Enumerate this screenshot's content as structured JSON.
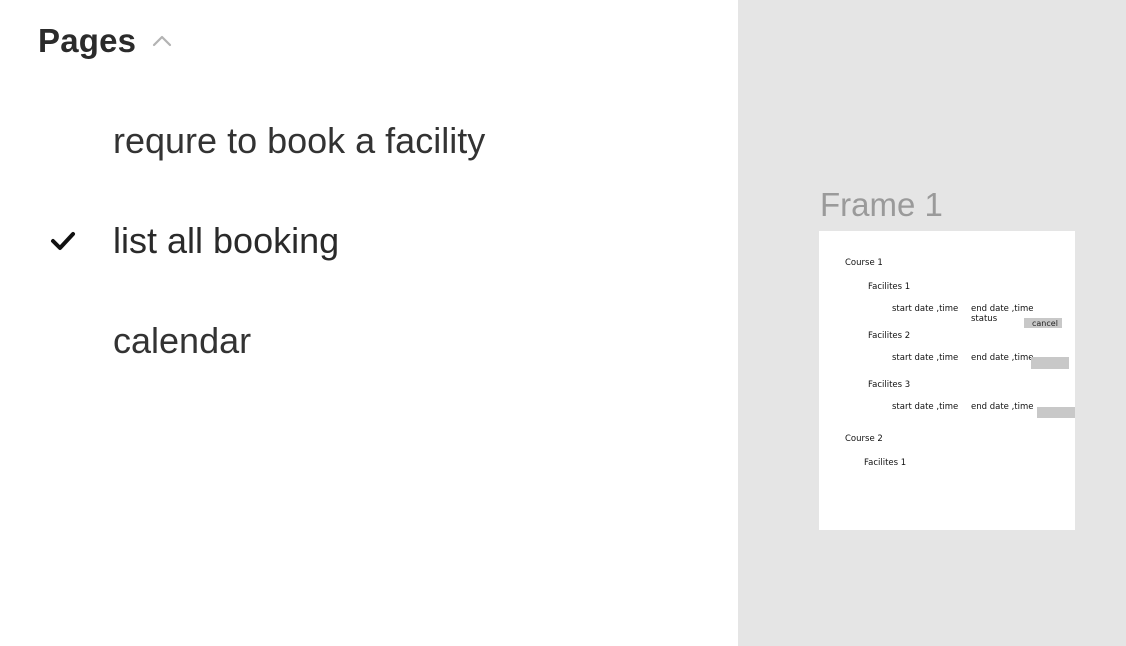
{
  "pages_panel": {
    "title": "Pages",
    "collapse_icon": "chevron-up-icon",
    "items": [
      {
        "label": "requre to book a facility",
        "selected": false
      },
      {
        "label": "list all booking",
        "selected": true
      },
      {
        "label": "calendar",
        "selected": false
      }
    ],
    "selected_icon": "check-icon"
  },
  "canvas": {
    "background": "#e5e5e5",
    "frame": {
      "label": "Frame 1",
      "content": {
        "course_1": "Course 1",
        "facility_1": "Facilites 1",
        "facility_1_start": "start date ,time",
        "facility_1_end": "end date ,time",
        "facility_1_status": "status",
        "cancel_label": "cancel",
        "facility_2": "Facilites 2",
        "facility_2_start": "start date ,time",
        "facility_2_end": "end date ,time",
        "facility_3": "Facilites 3",
        "facility_3_start": "start date ,time",
        "facility_3_end": "end date ,time",
        "course_2": "Course 2",
        "course_2_facility_1": "Facilites 1"
      }
    }
  }
}
